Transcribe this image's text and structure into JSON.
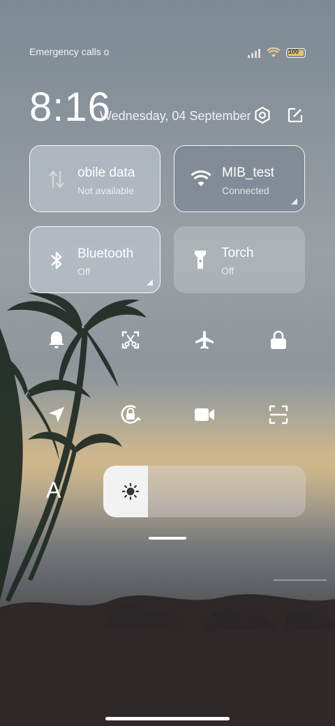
{
  "status_bar": {
    "carrier_text": "Emergency calls o",
    "battery_level": "100",
    "icons": [
      "signal-icon",
      "wifi-icon",
      "battery-icon"
    ]
  },
  "header": {
    "time": "8:16",
    "date": "Wednesday, 04 September",
    "icons": [
      "settings-icon",
      "edit-icon"
    ]
  },
  "tiles": {
    "mobile_data": {
      "title": "obile data",
      "subtitle": "Not available"
    },
    "wifi": {
      "title": "MIB_test",
      "subtitle": "Connected"
    },
    "bluetooth": {
      "title": "Bluetooth",
      "subtitle": "Off"
    },
    "torch": {
      "title": "Torch",
      "subtitle": "Off"
    }
  },
  "quick_toggles": [
    "bell-icon",
    "screenshot-icon",
    "airplane-icon",
    "lock-icon",
    "location-icon",
    "rotation-lock-icon",
    "video-camera-icon",
    "scan-icon"
  ],
  "brightness": {
    "level_percent": 22,
    "icon": "sun-icon"
  },
  "auto_text": "A"
}
